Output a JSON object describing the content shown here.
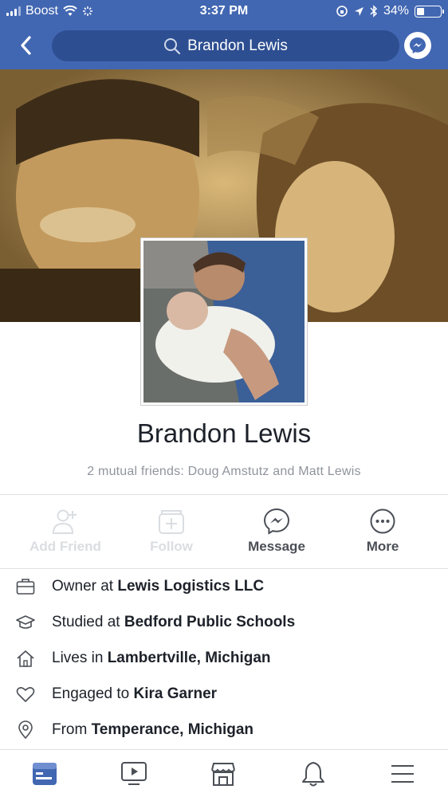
{
  "status_bar": {
    "carrier": "Boost",
    "time": "3:37 PM",
    "battery": "34%",
    "battery_level": 0.34
  },
  "nav": {
    "search_value": "Brandon Lewis",
    "back_icon": "chevron-left-icon",
    "messenger_icon": "messenger-icon"
  },
  "profile": {
    "name": "Brandon Lewis",
    "mutual_friends": "2 mutual friends: Doug Amstutz and Matt Lewis"
  },
  "actions": [
    {
      "label": "Add Friend",
      "icon": "add-friend-icon",
      "enabled": false
    },
    {
      "label": "Follow",
      "icon": "follow-icon",
      "enabled": false
    },
    {
      "label": "Message",
      "icon": "messenger-icon",
      "enabled": true
    },
    {
      "label": "More",
      "icon": "more-icon",
      "enabled": true
    }
  ],
  "info": [
    {
      "icon": "briefcase-icon",
      "prefix": "Owner at ",
      "value": "Lewis Logistics LLC"
    },
    {
      "icon": "graduation-cap-icon",
      "prefix": "Studied at ",
      "value": "Bedford Public Schools"
    },
    {
      "icon": "home-icon",
      "prefix": "Lives in ",
      "value": "Lambertville, Michigan"
    },
    {
      "icon": "heart-icon",
      "prefix": "Engaged to ",
      "value": "Kira Garner"
    },
    {
      "icon": "location-pin-icon",
      "prefix": "From ",
      "value": "Temperance, Michigan"
    }
  ],
  "tabs": [
    {
      "icon": "news-feed-icon",
      "active": true
    },
    {
      "icon": "watch-icon",
      "active": false
    },
    {
      "icon": "marketplace-icon",
      "active": false
    },
    {
      "icon": "notifications-icon",
      "active": false
    },
    {
      "icon": "menu-icon",
      "active": false
    }
  ],
  "colors": {
    "brand": "#4267b2",
    "search_pill": "#2d4e91",
    "active_tab": "#4267b2",
    "muted_text": "#90949c",
    "disabled": "#dadde1"
  }
}
